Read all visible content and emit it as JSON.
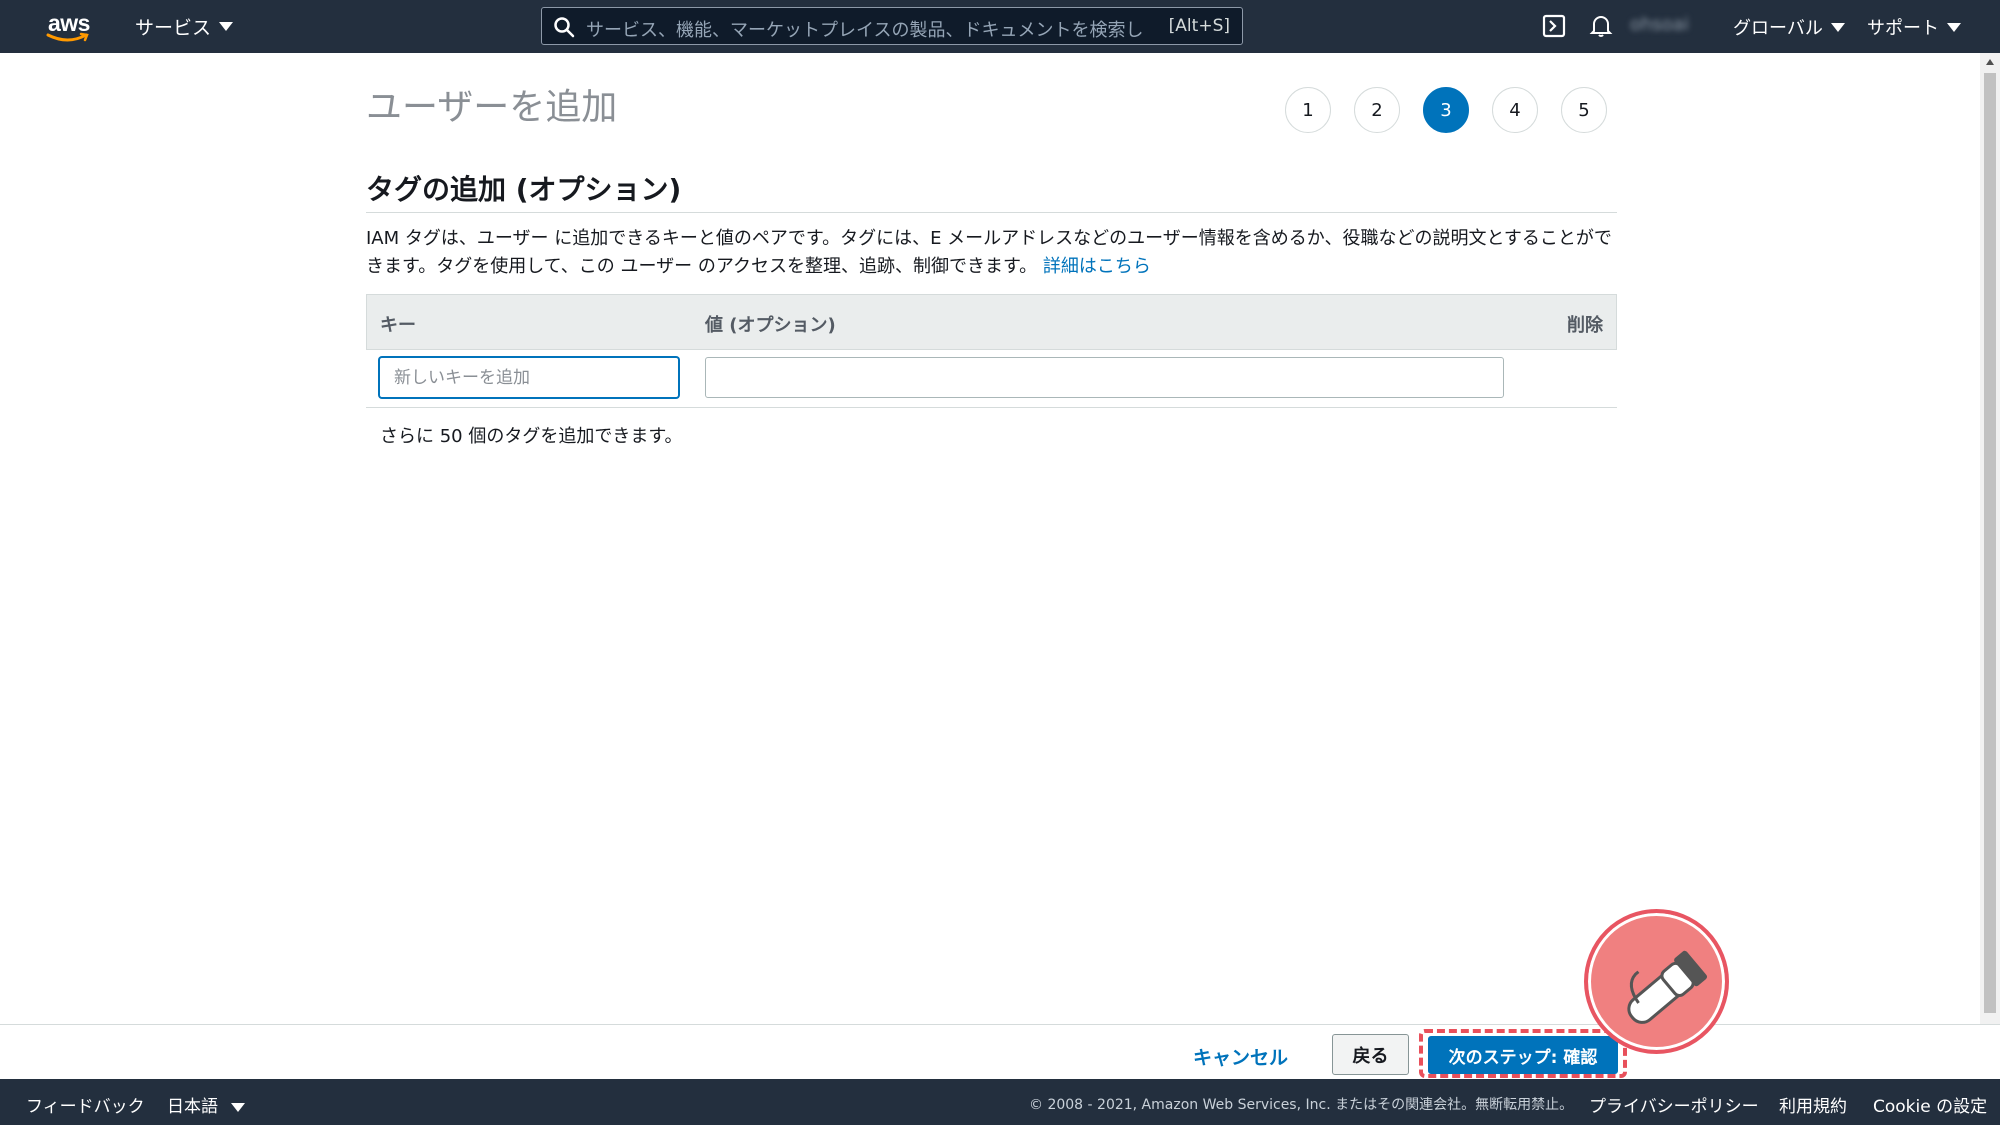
{
  "topnav": {
    "logo_text": "aws",
    "services_label": "サービス",
    "search_placeholder": "サービス、機能、マーケットプレイスの製品、ドキュメントを検索し",
    "search_shortcut": "[Alt+S]",
    "user_label": "ohsoai",
    "region_label": "グローバル",
    "support_label": "サポート"
  },
  "page": {
    "title": "ユーザーを追加",
    "steps": [
      "1",
      "2",
      "3",
      "4",
      "5"
    ],
    "active_step": "3",
    "section_title": "タグの追加 (オプション)",
    "description": "IAM タグは、ユーザー に追加できるキーと値のペアです。タグには、E メールアドレスなどのユーザー情報を含めるか、役職などの説明文とすることができます。タグを使用して、この ユーザー のアクセスを整理、追跡、制御できます。",
    "learn_more": "詳細はこちら",
    "table": {
      "col_key": "キー",
      "col_value": "値 (オプション)",
      "col_remove": "削除",
      "key_placeholder": "新しいキーを追加",
      "value_value": ""
    },
    "remaining_text": "さらに 50 個のタグを追加できます。"
  },
  "actions": {
    "cancel": "キャンセル",
    "back": "戻る",
    "next": "次のステップ: 確認"
  },
  "footer": {
    "feedback": "フィードバック",
    "language": "日本語",
    "copyright": "© 2008 - 2021, Amazon Web Services, Inc. またはその関連会社。無断転用禁止。",
    "privacy": "プライバシーポリシー",
    "terms": "利用規約",
    "cookie": "Cookie の設定"
  },
  "colors": {
    "nav_bg": "#232f3e",
    "accent": "#0073bb",
    "highlight": "#e8505b",
    "aws_orange": "#ff9900"
  }
}
